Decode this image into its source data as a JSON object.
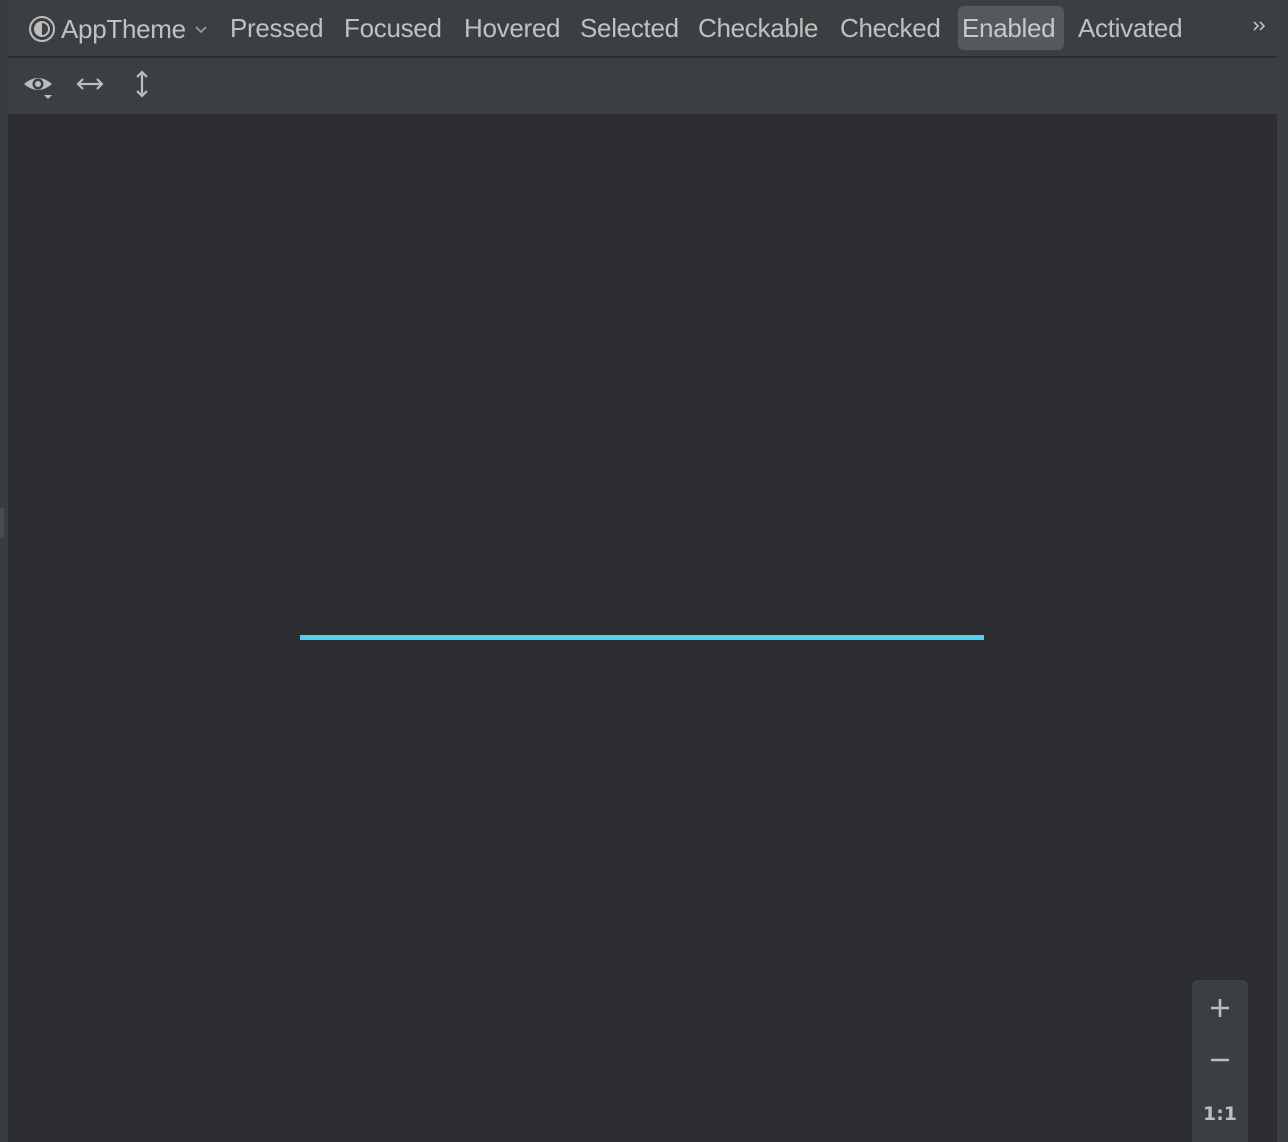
{
  "theme": {
    "label": "AppTheme",
    "icon": "contrast-icon",
    "dropdown_icon": "chevron-down-icon"
  },
  "states": [
    {
      "label": "Pressed",
      "active": false
    },
    {
      "label": "Focused",
      "active": false
    },
    {
      "label": "Hovered",
      "active": false
    },
    {
      "label": "Selected",
      "active": false
    },
    {
      "label": "Checkable",
      "active": false
    },
    {
      "label": "Checked",
      "active": false
    },
    {
      "label": "Enabled",
      "active": true
    },
    {
      "label": "Activated",
      "active": false
    }
  ],
  "toolbar": {
    "overflow_icon": "double-chevron-right-icon",
    "view_icons": [
      "eye-icon",
      "horizontal-resize-icon",
      "vertical-resize-icon"
    ]
  },
  "preview": {
    "shape": "horizontal-line",
    "color": "#4fd1f0"
  },
  "zoom": {
    "zoom_in_icon": "plus-icon",
    "zoom_out_icon": "minus-icon",
    "actual_size_label": "1:1"
  },
  "colors": {
    "canvas": "#2c2d30",
    "toolbar": "#3c3f41",
    "active_state_bg": "#56595c"
  }
}
